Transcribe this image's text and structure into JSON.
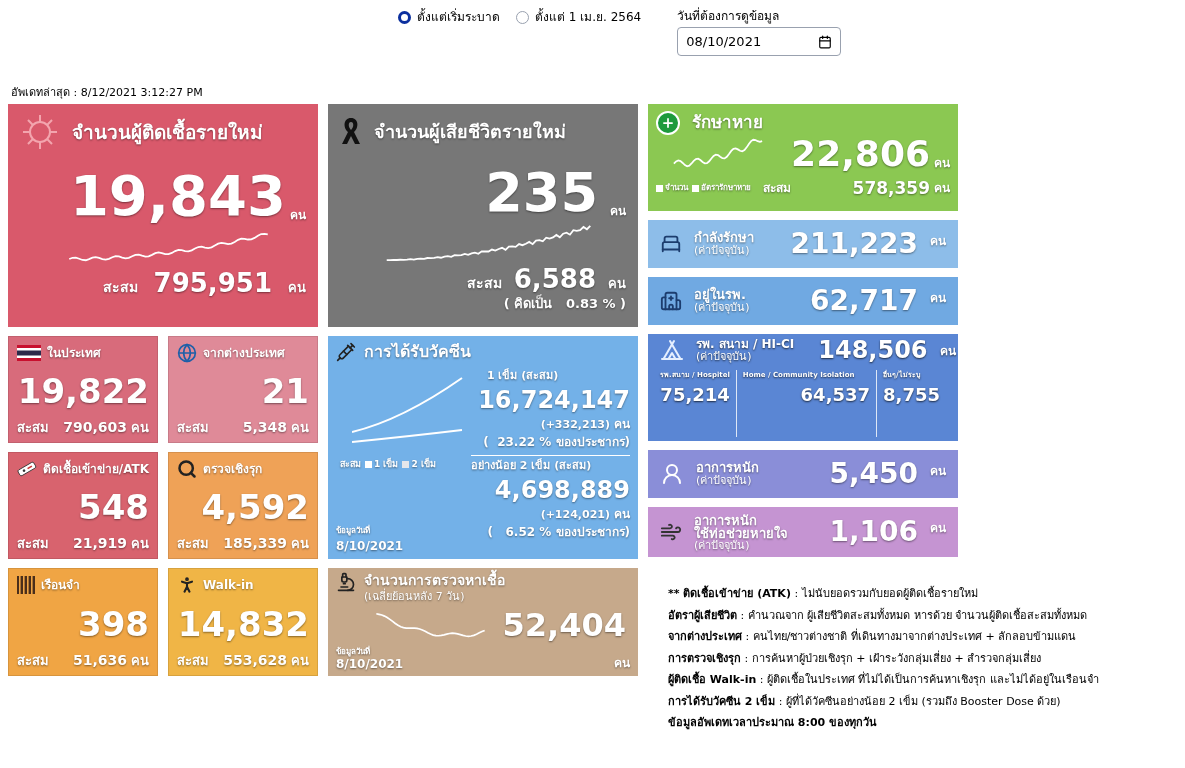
{
  "filters": [
    {
      "label": "ตั้งแต่เริ่มระบาด",
      "selected": true
    },
    {
      "label": "ตั้งแต่ 1 เม.ย. 2564",
      "selected": false
    }
  ],
  "date_field": {
    "label": "วันที่ต้องการดูข้อมูล",
    "value": "08/10/2021"
  },
  "last_updated": "อัพเดทล่าสุด : 8/12/2021 3:12:27 PM",
  "new_cases": {
    "title": "จำนวนผู้ติดเชื้อรายใหม่",
    "value": "19,843",
    "unit": "คน",
    "total_label": "สะสม",
    "total": "795,951",
    "total_unit": "คน"
  },
  "deaths": {
    "title": "จำนวนผู้เสียชีวิตรายใหม่",
    "value": "235",
    "unit": "คน",
    "total_label": "สะสม",
    "total": "6,588",
    "total_unit": "คน",
    "rate": "( คิดเป็น   0.83 % )"
  },
  "small_cards": [
    {
      "title": "ในประเทศ",
      "value": "19,822",
      "total_label": "สะสม",
      "total": "790,603",
      "unit": "คน",
      "color": "#d86b7b"
    },
    {
      "title": "จากต่างประเทศ",
      "value": "21",
      "total_label": "สะสม",
      "total": "5,348",
      "unit": "คน",
      "color": "#df8a98"
    },
    {
      "title": "ติดเชื้อเข้าข่าย/ATK",
      "value": "548",
      "total_label": "สะสม",
      "total": "21,919",
      "unit": "คน",
      "color": "#d8636e"
    },
    {
      "title": "ตรวจเชิงรุก",
      "value": "4,592",
      "total_label": "สะสม",
      "total": "185,339",
      "unit": "คน",
      "color": "#efa257"
    },
    {
      "title": "เรือนจำ",
      "value": "398",
      "total_label": "สะสม",
      "total": "51,636",
      "unit": "คน",
      "color": "#f0a544"
    },
    {
      "title": "Walk-in",
      "value": "14,832",
      "total_label": "สะสม",
      "total": "553,628",
      "unit": "คน",
      "color": "#f0b546"
    }
  ],
  "vaccine": {
    "title": "การได้รับวัคซีน",
    "legend_label": "สะสม",
    "legend": [
      "1 เข็ม",
      "2 เข็ม"
    ],
    "date_label": "ข้อมูลวันที่",
    "date": "8/10/2021",
    "doses": [
      {
        "label": "1 เข็ม (สะสม)",
        "value": "16,724,147",
        "change": "(+332,213)",
        "unit": "คน",
        "share": "(  23.22 % ของประชากร)"
      },
      {
        "label": "อย่างน้อย 2 เข็ม (สะสม)",
        "value": "4,698,889",
        "change": "(+124,021)",
        "unit": "คน",
        "share": "(   6.52 % ของประชากร)"
      }
    ]
  },
  "tests": {
    "title": "จำนวนการตรวจหาเชื้อ",
    "subtitle": "(เฉลี่ยย้อนหลัง 7 วัน)",
    "value": "52,404",
    "unit": "คน",
    "date_label": "ข้อมูลวันที่",
    "date": "8/10/2021"
  },
  "recovered": {
    "title": "รักษาหาย",
    "value": "22,806",
    "unit": "คน",
    "legend": [
      "จำนวน",
      "อัตรารักษาหาย"
    ],
    "total_label": "สะสม",
    "total": "578,359",
    "total_unit": "คน"
  },
  "current": [
    {
      "title": [
        "กำลังรักษา",
        "(ค่าปัจจุบัน)"
      ],
      "value": "211,223",
      "unit": "คน",
      "color": "#8dbde9"
    },
    {
      "title": [
        "อยู่ในรพ.",
        "(ค่าปัจจุบัน)"
      ],
      "value": "62,717",
      "unit": "คน",
      "color": "#70a9e2"
    }
  ],
  "field_hospital": {
    "title": [
      "รพ. สนาม / HI-CI",
      "(ค่าปัจจุบัน)"
    ],
    "value": "148,506",
    "unit": "คน",
    "breakdown": [
      {
        "label": "รพ.สนาม / Hospitel",
        "value": "75,214"
      },
      {
        "label": "Home / Community Isolation",
        "value": "64,537"
      },
      {
        "label": "อื่นๆ/ไม่ระบุ",
        "value": "8,755"
      }
    ]
  },
  "severe": [
    {
      "title": [
        "อาการหนัก",
        "(ค่าปัจจุบัน)"
      ],
      "value": "5,450",
      "unit": "คน",
      "color": "#8a8ed8"
    },
    {
      "title": [
        "อาการหนัก",
        "ใช้ท่อช่วยหายใจ",
        "(ค่าปัจจุบัน)"
      ],
      "value": "1,106",
      "unit": "คน",
      "color": "#c594d2"
    }
  ],
  "notes": [
    {
      "term": "** ติดเชื้อเข้าข่าย (ATK)",
      "definition": " : ไม่นับยอดรวมกับยอดผู้ติดเชื้อรายใหม่"
    },
    {
      "term": "อัตราผู้เสียชีวิต",
      "definition": " : คำนวณจาก ผู้เสียชีวิตสะสมทั้งหมด หารด้วย จำนวนผู้ติดเชื้อสะสมทั้งหมด"
    },
    {
      "term": "จากต่างประเทศ",
      "definition": " : คนไทย/ชาวต่างชาติ ที่เดินทางมาจากต่างประเทศ + ลักลอบข้ามแดน"
    },
    {
      "term": "การตรวจเชิงรุก",
      "definition": " : การค้นหาผู้ป่วยเชิงรุก + เฝ้าระวังกลุ่มเสี่ยง + สำรวจกลุ่มเสี่ยง"
    },
    {
      "term": "ผู้ติดเชื้อ Walk-in",
      "definition": " : ผู้ติดเชื้อในประเทศ ที่ไม่ได้เป็นการค้นหาเชิงรุก และไม่ได้อยู่ในเรือนจำ"
    },
    {
      "term": "การได้รับวัคซีน 2 เข็ม",
      "definition": " : ผู้ที่ได้วัคซีนอย่างน้อย 2 เข็ม (รวมถึง Booster Dose ด้วย)"
    },
    {
      "term": "ข้อมูลอัพเดทเวลาประมาณ 8:00 ของทุกวัน"
    }
  ]
}
